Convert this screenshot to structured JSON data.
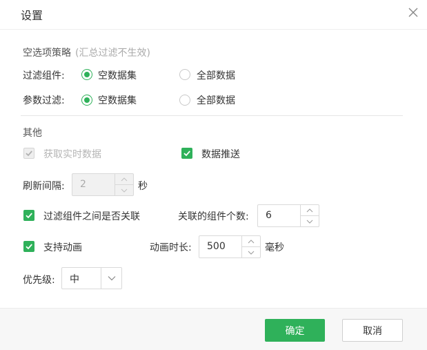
{
  "dialog": {
    "title": "设置"
  },
  "empty_strategy": {
    "label": "空选项策略",
    "hint": "(汇总过滤不生效)",
    "filter_component": {
      "label": "过滤组件:",
      "options": [
        "空数据集",
        "全部数据"
      ],
      "selected": "空数据集"
    },
    "param_filter": {
      "label": "参数过滤:",
      "options": [
        "空数据集",
        "全部数据"
      ],
      "selected": "空数据集"
    }
  },
  "other": {
    "label": "其他",
    "realtime_data": {
      "label": "获取实时数据",
      "checked": true,
      "disabled": true
    },
    "data_push": {
      "label": "数据推送",
      "checked": true
    },
    "refresh": {
      "label": "刷新间隔:",
      "value": "2",
      "unit": "秒"
    },
    "filter_link": {
      "label": "过滤组件之间是否关联",
      "checked": true
    },
    "linked_count": {
      "label": "关联的组件个数:",
      "value": "6"
    },
    "animation": {
      "label": "支持动画",
      "checked": true
    },
    "animation_duration": {
      "label": "动画时长:",
      "value": "500",
      "unit": "毫秒"
    },
    "priority": {
      "label": "优先级:",
      "value": "中"
    }
  },
  "footer": {
    "ok_label": "确定",
    "cancel_label": "取消"
  },
  "colors": {
    "accent": "#2fb15a",
    "border": "#d9d9d9",
    "footer_bg": "#f7f7f7"
  },
  "icons": [
    "close-icon",
    "check-icon",
    "chevron-up-icon",
    "chevron-down-icon"
  ]
}
